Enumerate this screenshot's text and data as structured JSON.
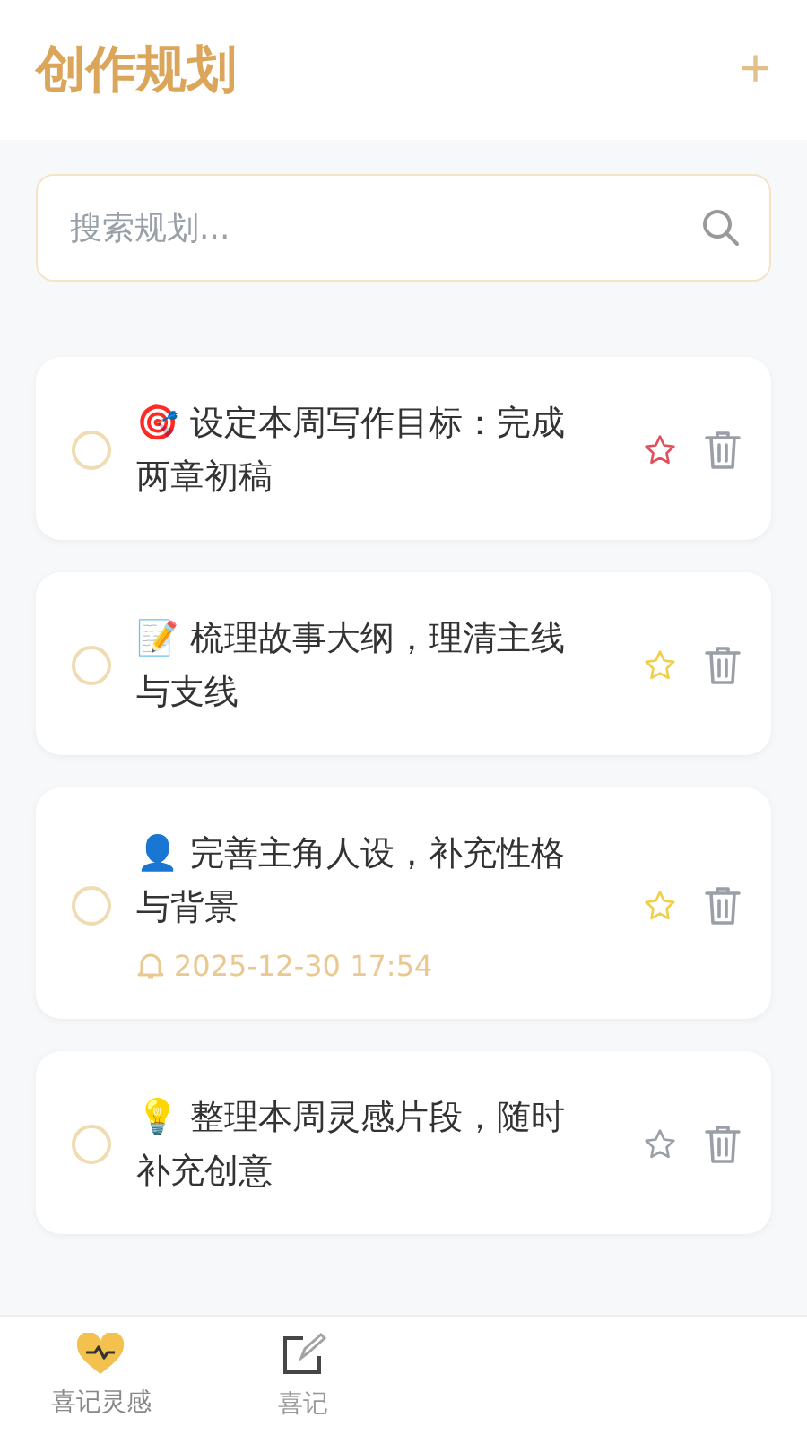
{
  "header": {
    "title": "创作规划",
    "add_button": "+"
  },
  "search": {
    "placeholder": "搜索规划..."
  },
  "plans": [
    {
      "emoji": "🎯",
      "text": "设定本周写作目标：完成两章初稿",
      "done": false,
      "color": "#e0505a"
    },
    {
      "emoji": "📝",
      "text": "梳理故事大纲，理清主线与支线",
      "done": false,
      "color": "#f2cf4a"
    },
    {
      "emoji": "👤",
      "text": "完善主角人设，补充性格与背景",
      "done": false,
      "color": "#f2cf4a",
      "reminder": "2025-12-30 17:54"
    },
    {
      "emoji": "💡",
      "text": "整理本周灵感片段，随时补充创意",
      "done": false,
      "color": "#9aa0a8"
    }
  ],
  "tab_bar": [
    {
      "label": "喜记灵感",
      "kind": "heart",
      "selected": true
    },
    {
      "label": "喜记",
      "kind": "edit",
      "selected": false
    }
  ]
}
